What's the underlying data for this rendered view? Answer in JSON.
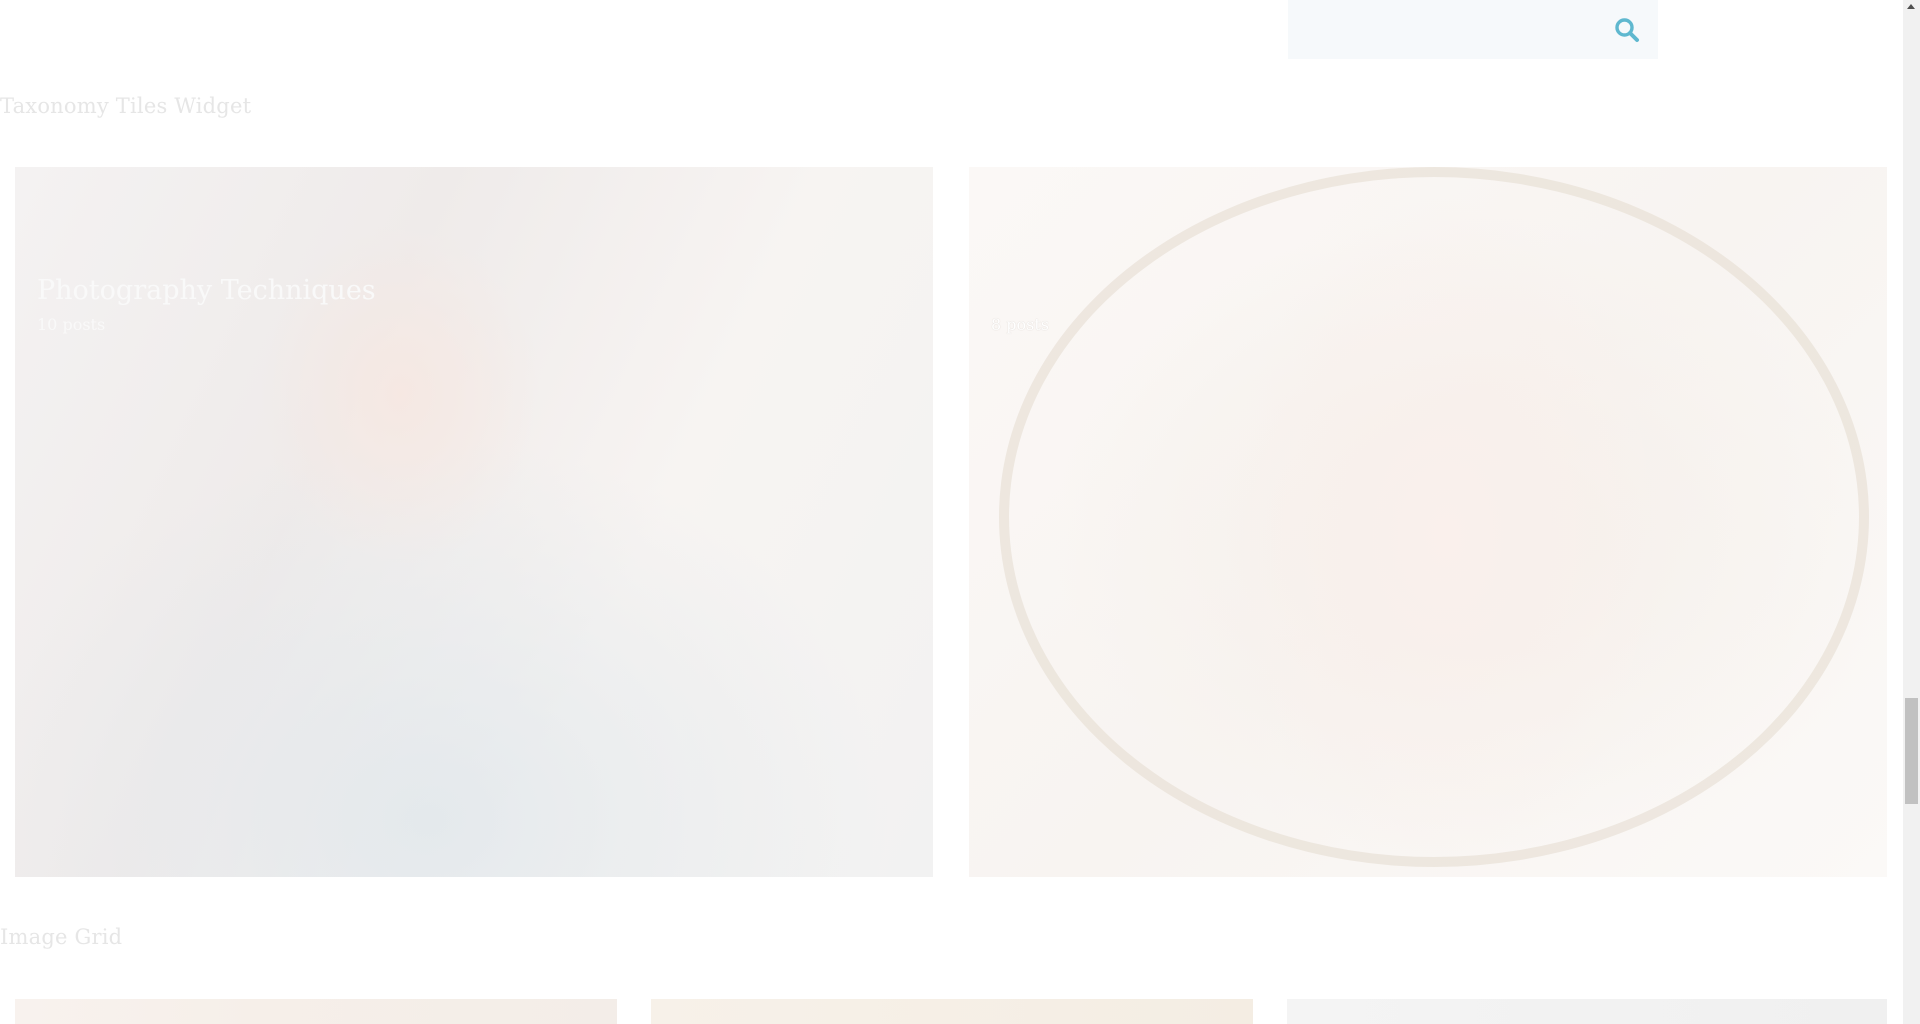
{
  "search": {
    "placeholder": "",
    "icon": "search-icon",
    "icon_color": "#5fb8cf"
  },
  "sections": {
    "taxonomy_heading": "Taxonomy Tiles Widget",
    "image_grid_heading": "Image Grid"
  },
  "tiles": [
    {
      "title": "Photography Techniques",
      "count": "10 posts"
    },
    {
      "title": "",
      "count": "8 posts"
    }
  ],
  "colors": {
    "heading": "#e6e6e6",
    "search_bg": "#f6f9fb",
    "accent": "#5fb8cf"
  }
}
